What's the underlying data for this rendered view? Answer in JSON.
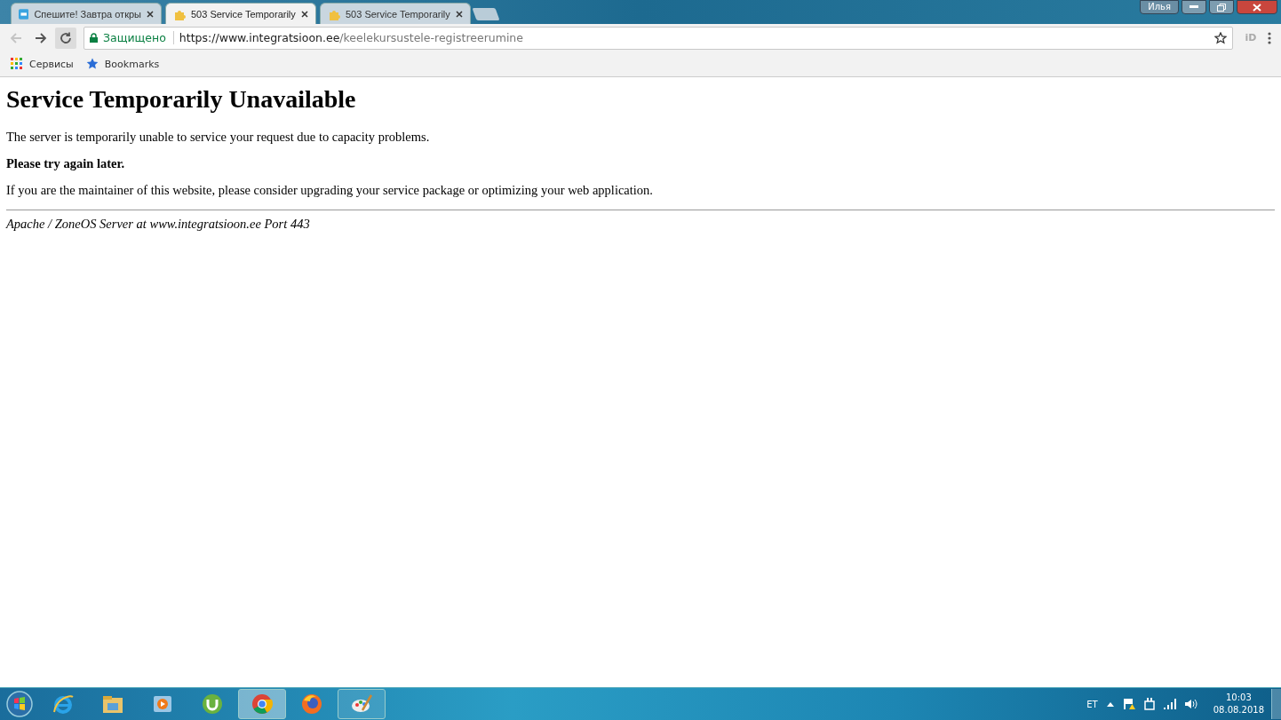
{
  "window": {
    "user": "Илья"
  },
  "tabs": [
    {
      "title": "Спешите! Завтра откры",
      "selected": false
    },
    {
      "title": "503 Service Temporarily",
      "selected": true
    },
    {
      "title": "503 Service Temporarily",
      "selected": false
    }
  ],
  "toolbar": {
    "back_disabled": true,
    "security": "Защищено",
    "url_host": "https://www.integratsioon.ee",
    "url_path": "/keelekursustele-registreerumine",
    "extension": "iD"
  },
  "bookmarks": [
    {
      "label": "Сервисы"
    },
    {
      "label": "Bookmarks"
    }
  ],
  "page": {
    "heading": "Service Temporarily Unavailable",
    "paragraphs": [
      {
        "text": "The server is temporarily unable to service your request due to capacity problems.",
        "bold": false
      },
      {
        "text": "Please try again later.",
        "bold": true
      },
      {
        "text": "If you are the maintainer of this website, please consider upgrading your service package or optimizing your web application.",
        "bold": false
      }
    ],
    "address": "Apache / ZoneOS Server at www.integratsioon.ee Port 443"
  },
  "taskbar": {
    "apps": [
      {
        "running": false,
        "selected": false
      },
      {
        "running": false,
        "selected": false
      },
      {
        "running": false,
        "selected": false
      },
      {
        "running": false,
        "selected": false
      },
      {
        "running": true,
        "selected": true
      },
      {
        "running": false,
        "selected": false
      },
      {
        "running": true,
        "selected": false
      }
    ],
    "language": "ET",
    "time": "10:03",
    "date": "08.08.2018"
  }
}
